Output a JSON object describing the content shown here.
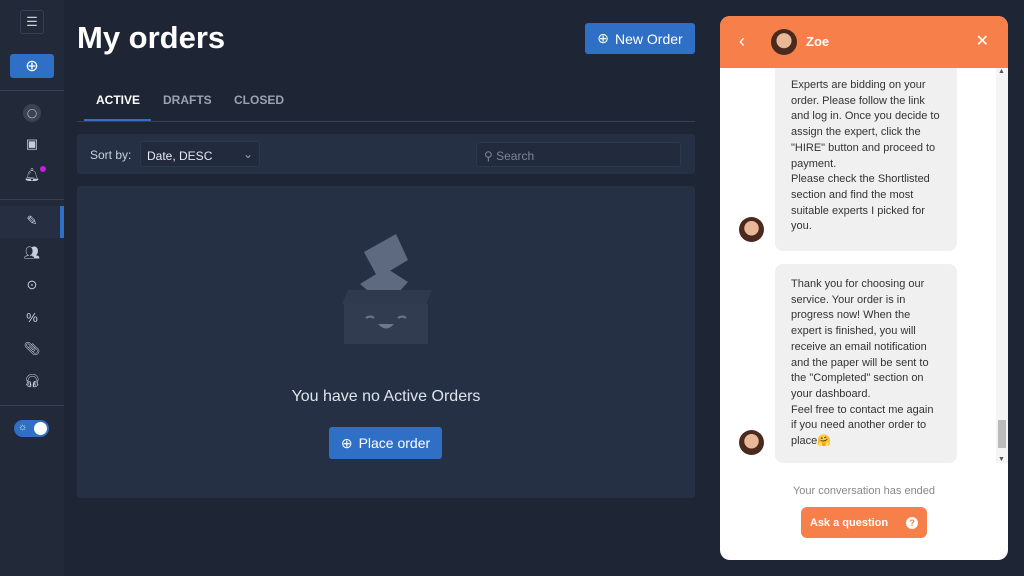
{
  "sidebar": {
    "icons": [
      "collapse-menu-icon",
      "plus-circle-icon",
      "profile-icon",
      "wallet-icon",
      "bell-icon",
      "edit-orders-icon",
      "experts-icon",
      "chat-icon",
      "discount-icon",
      "attachment-icon",
      "support-icon",
      "theme-toggle"
    ],
    "notification_color": "#c21fe0"
  },
  "header": {
    "title": "My orders",
    "new_order": "New Order"
  },
  "tabs": [
    {
      "label": "ACTIVE"
    },
    {
      "label": "DRAFTS"
    },
    {
      "label": "CLOSED"
    }
  ],
  "toolbar": {
    "sort_label": "Sort by:",
    "sort_value": "Date, DESC",
    "search_placeholder": "Search"
  },
  "empty": {
    "message": "You have no Active Orders",
    "place_order": "Place order"
  },
  "chat": {
    "agent_name": "Zoe",
    "header_color": "#f7804a",
    "messages": [
      "Experts are bidding on your order. Please follow the link and log in. Once you decide to assign the expert, click the \"HIRE\" button and proceed to payment.\nPlease check the Shortlisted section and find the most suitable experts I picked for you.",
      "Thank you for choosing our service. Your order is in progress now! When the expert is finished, you will receive an email notification and the paper will be sent to the \"Completed\" section on your dashboard.\nFeel free to contact me again if you need another order to place🤗"
    ],
    "ended": "Your conversation has ended",
    "ask": "Ask a question"
  }
}
